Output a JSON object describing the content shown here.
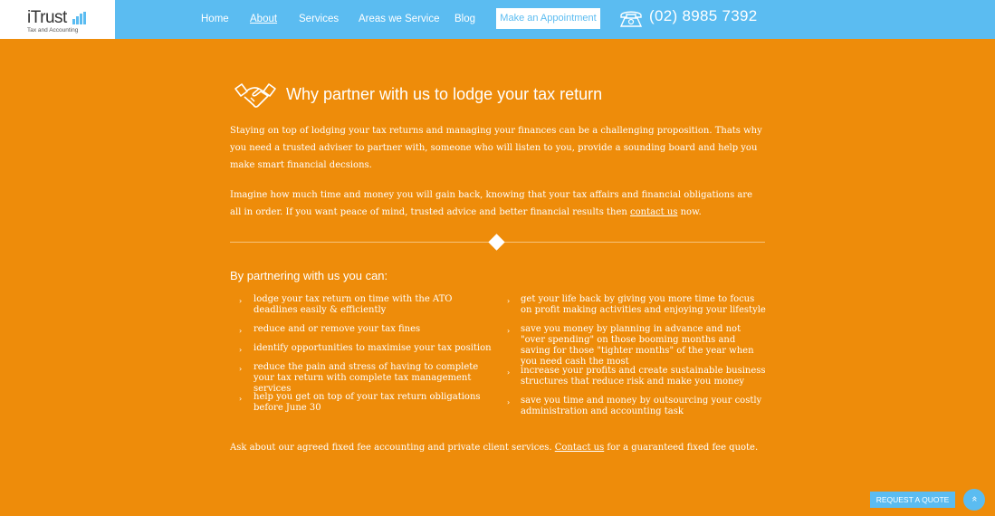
{
  "brand": {
    "name": "iTrust",
    "tagline": "Tax and Accounting"
  },
  "nav": {
    "items": [
      "Home",
      "About",
      "Services",
      "Areas we Service",
      "Blog"
    ],
    "active": "About",
    "appointment_label": "Make an Appointment",
    "phone": "(02) 8985 7392"
  },
  "section": {
    "icon": "handshake-icon",
    "title": "Why partner with us to lodge your tax return",
    "para1": "Staying on top of lodging your tax returns and managing your finances can be a challenging proposition. Thats why you need a trusted adviser to partner with, someone who will listen to you, provide a sounding board and help you make smart financial decsions.",
    "para2_before": "Imagine how much time and money you will gain back, knowing that your tax affairs and financial obligations are all in order. If you want peace of mind, trusted advice and better financial results then ",
    "para2_link": "contact us",
    "para2_after": " now."
  },
  "benefits": {
    "heading": "By partnering with us you can:",
    "left": [
      "lodge your tax return on time with the ATO deadlines easily & efficiently",
      "reduce and or remove your tax fines",
      "identify opportunities to maximise your tax position",
      "reduce the pain and stress of having to complete your tax return with complete tax management services",
      "help you get on top of your tax return obligations before June 30"
    ],
    "right": [
      "get your life back by giving you more time to focus on profit making activities and enjoying your lifestyle",
      "save you money by planning in advance and not \"over spending\" on those booming months and saving for those \"tighter months\" of the year when you need cash the most",
      "increase your profits and create sustainable business structures that reduce risk and make you money",
      "save you time and money by outsourcing your costly administration and accounting task"
    ]
  },
  "footer_note": {
    "before": "Ask about our agreed fixed fee accounting and private client services. ",
    "link": "Contact us",
    "after": " for a guaranteed fixed fee quote."
  },
  "floating": {
    "quote_label": "REQUEST A QUOTE",
    "top_icon": "chevron-double-up-icon"
  },
  "colors": {
    "background": "#ee8c0a",
    "header": "#5bbcf1",
    "accent_text": "#5bbcf1"
  }
}
